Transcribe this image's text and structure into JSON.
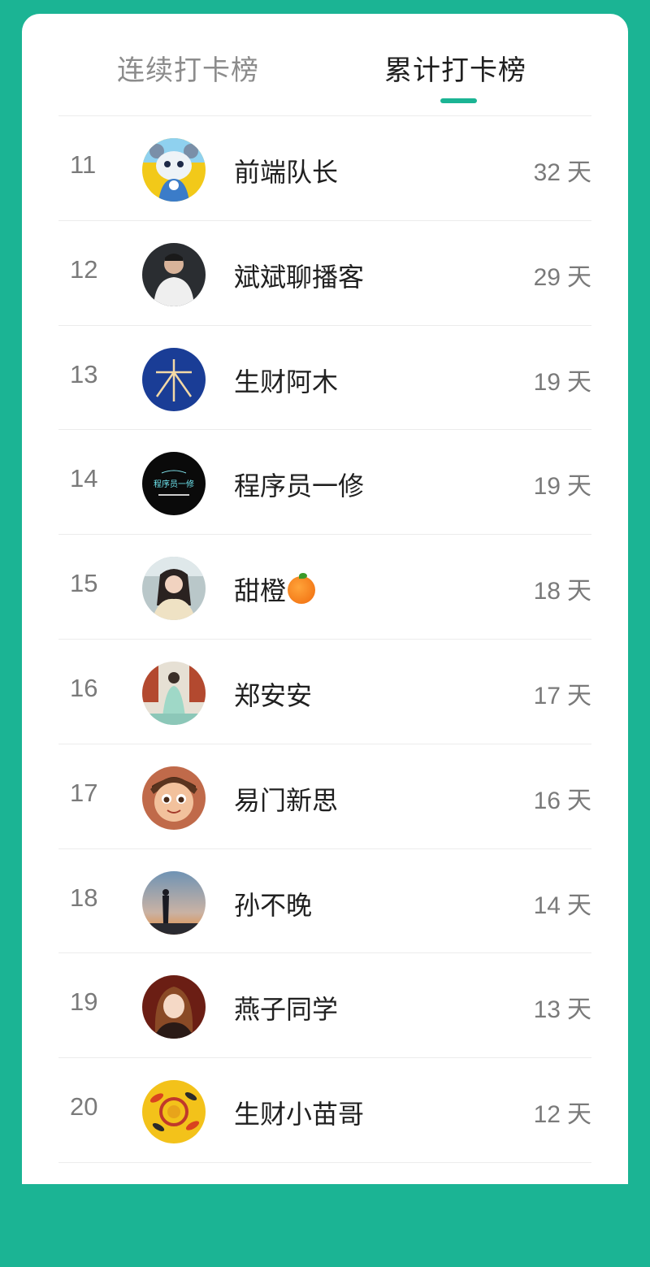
{
  "tabs": {
    "streak_label": "连续打卡榜",
    "total_label": "累计打卡榜",
    "active": "total"
  },
  "unit": "天",
  "rows": [
    {
      "rank": "11",
      "name": "前端队长",
      "days": "32",
      "avatar": "cartoon-bear-avatar"
    },
    {
      "rank": "12",
      "name": "斌斌聊播客",
      "days": "29",
      "avatar": "man-white-shirt-avatar"
    },
    {
      "rank": "13",
      "name": "生财阿木",
      "days": "19",
      "avatar": "wood-character-avatar"
    },
    {
      "rank": "14",
      "name": "程序员一修",
      "days": "19",
      "avatar": "programmer-logo-avatar",
      "avatar_text": "程序员一修"
    },
    {
      "rank": "15",
      "name": "甜橙",
      "days": "18",
      "avatar": "woman-photo-avatar",
      "emoji": "orange-emoji"
    },
    {
      "rank": "16",
      "name": "郑安安",
      "days": "17",
      "avatar": "hanfu-girl-avatar"
    },
    {
      "rank": "17",
      "name": "易门新思",
      "days": "16",
      "avatar": "cartoon-boy-avatar"
    },
    {
      "rank": "18",
      "name": "孙不晚",
      "days": "14",
      "avatar": "sunset-silhouette-avatar"
    },
    {
      "rank": "19",
      "name": "燕子同学",
      "days": "13",
      "avatar": "woman-portrait-avatar"
    },
    {
      "rank": "20",
      "name": "生财小苗哥",
      "days": "12",
      "avatar": "koi-fish-avatar"
    }
  ],
  "colors": {
    "brand": "#1bb494",
    "card": "#ffffff",
    "text": "#202020",
    "muted": "#7a7a7a"
  }
}
